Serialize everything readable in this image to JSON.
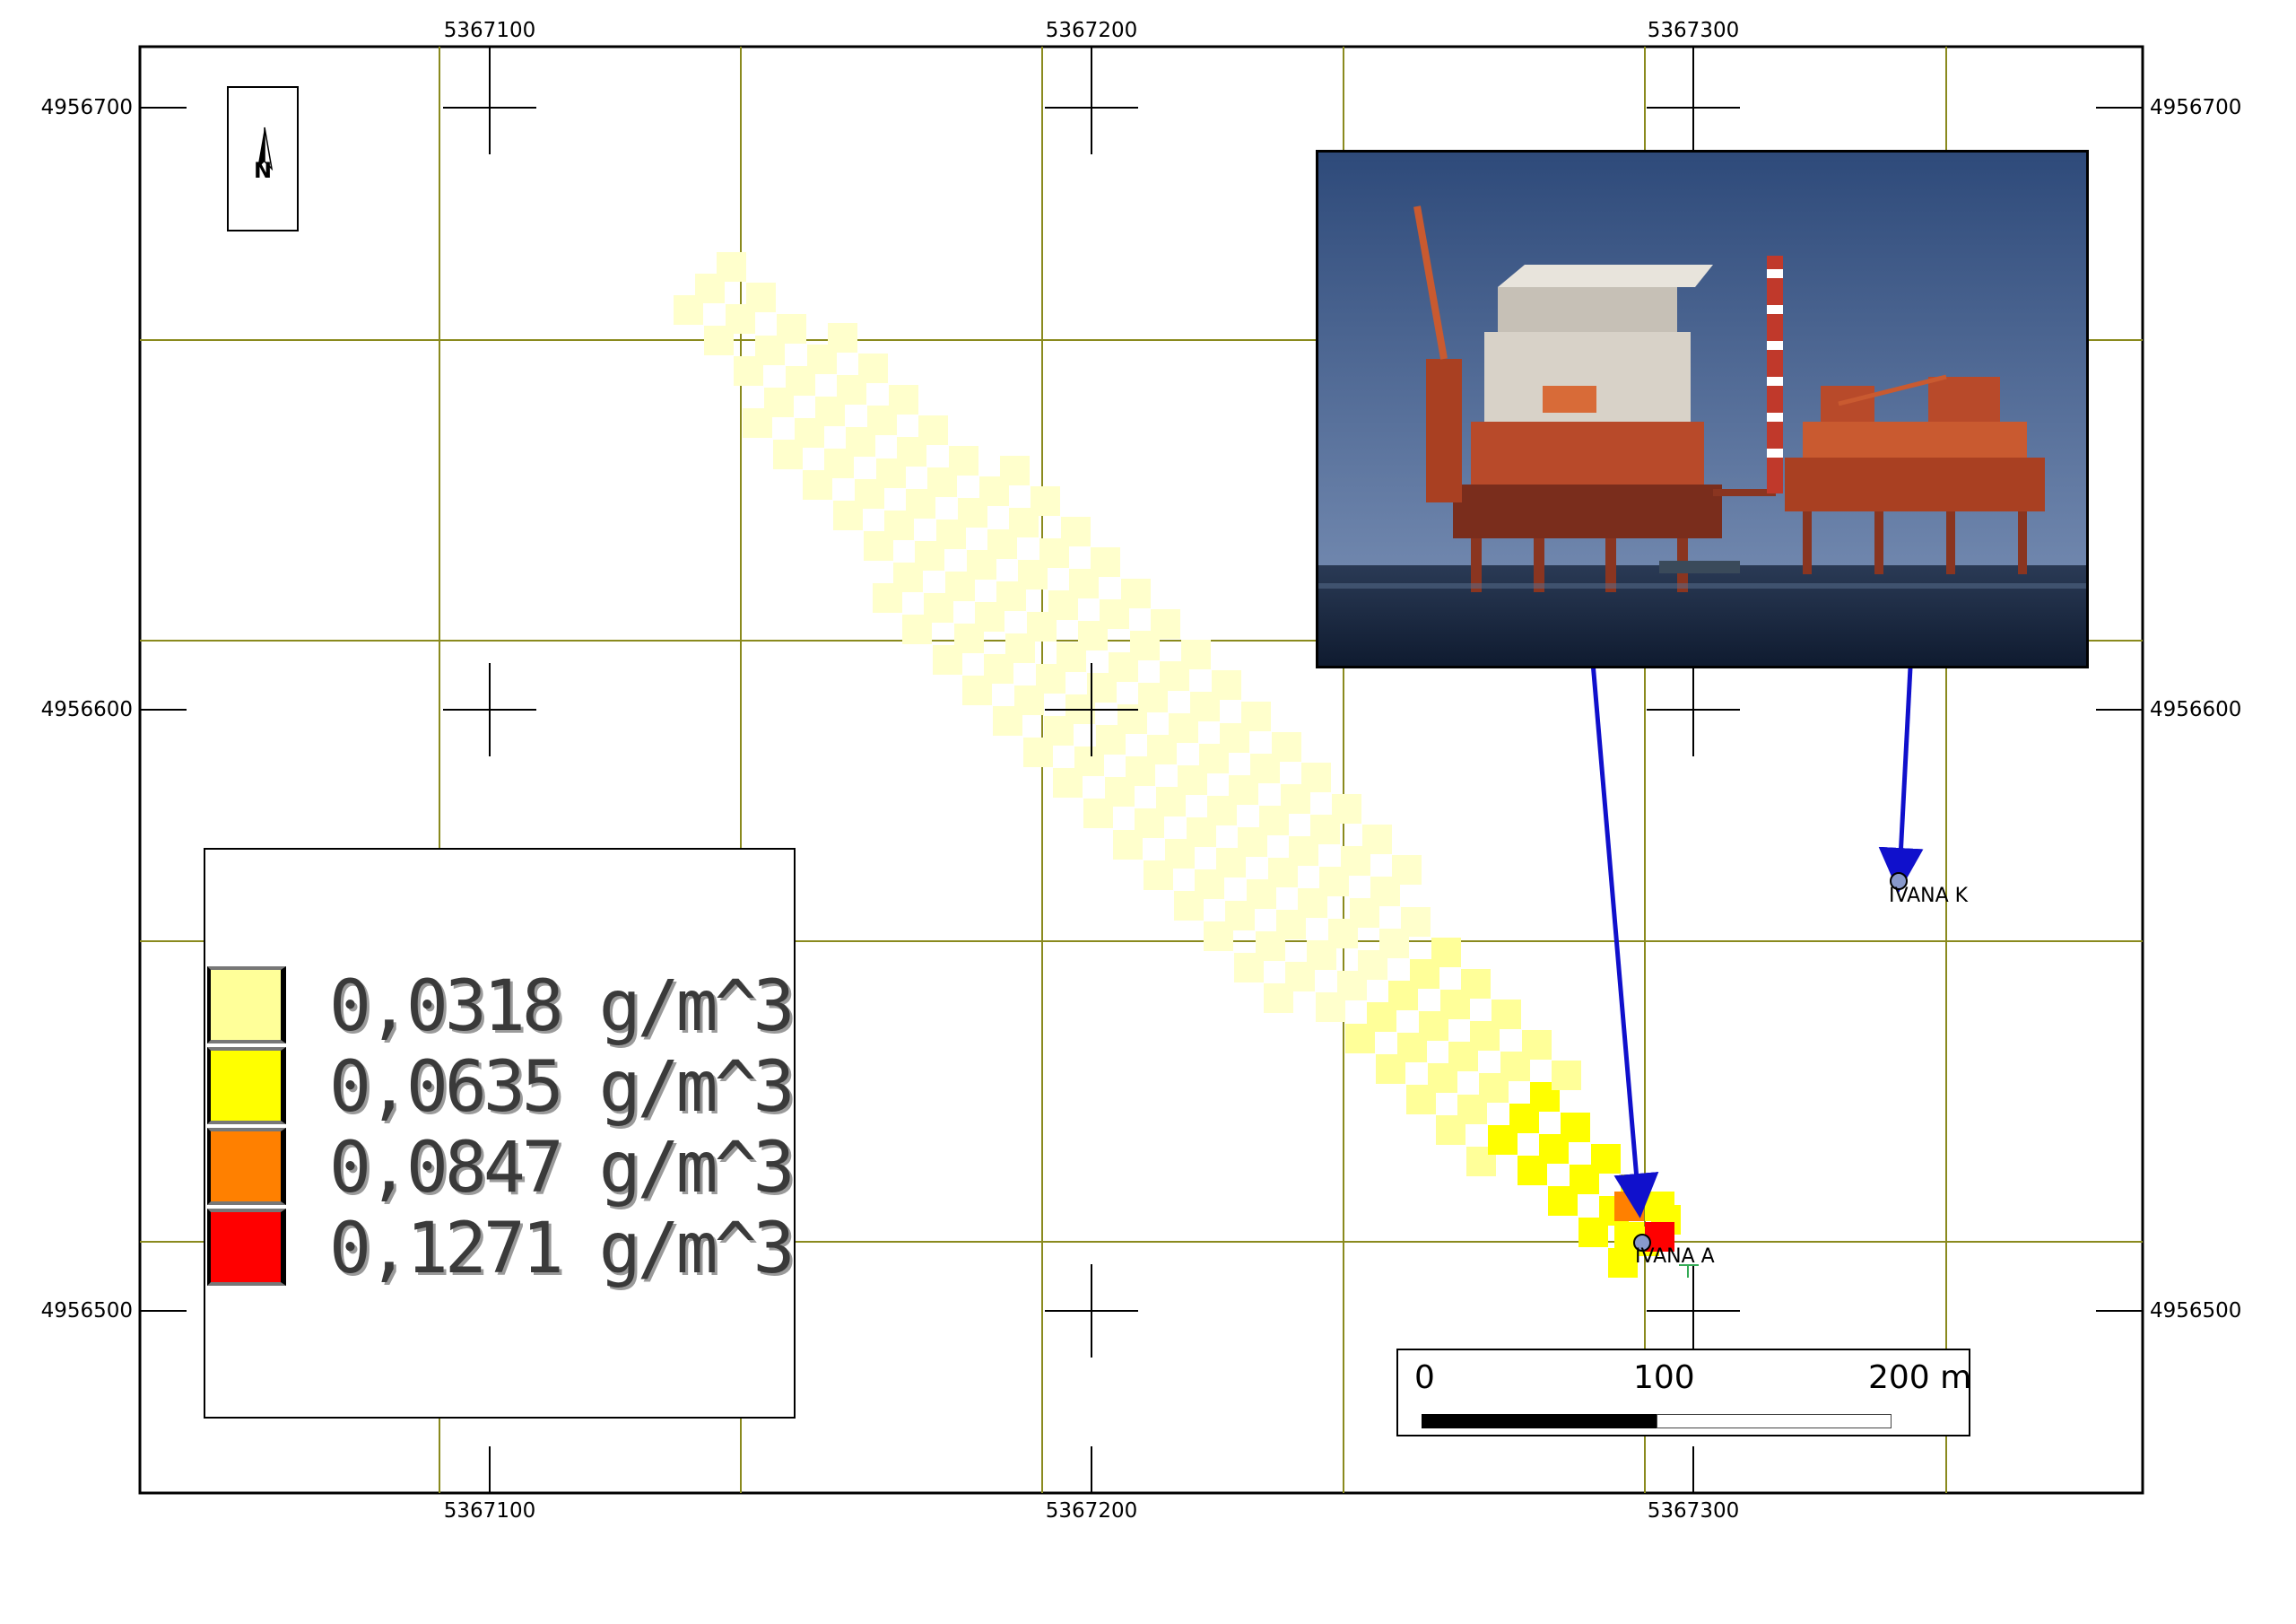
{
  "map": {
    "grid_x_labels": [
      "5367100",
      "5367200",
      "5367300"
    ],
    "grid_y_labels": [
      "4956700",
      "4956600",
      "4956500"
    ],
    "north_arrow": {
      "letter": "N",
      "icon": "north-arrow-icon"
    },
    "points": [
      {
        "id": "ivana-a",
        "label": "IVANA A"
      },
      {
        "id": "ivana-k",
        "label": "IVANA K"
      }
    ],
    "legend": {
      "items": [
        {
          "label": "0,0318 g/m^3",
          "color": "#ffff99"
        },
        {
          "label": "0,0635 g/m^3",
          "color": "#ffff00"
        },
        {
          "label": "0,0847 g/m^3",
          "color": "#ff8000"
        },
        {
          "label": "0,1271 g/m^3",
          "color": "#ff0000"
        }
      ]
    },
    "scalebar": {
      "labels": [
        "0",
        "100",
        "200 m"
      ]
    },
    "photo": {
      "subject": "offshore-gas-platforms-photo"
    },
    "colors": {
      "grid_line": "#8a8a1e",
      "arrow": "#1010cc",
      "point_fill": "#8899cc",
      "plume_light": "#ffffcc",
      "plume_mid": "#ffff99",
      "plume_high": "#ffff00",
      "plume_orange": "#ff8000",
      "plume_red": "#ff0000"
    }
  }
}
